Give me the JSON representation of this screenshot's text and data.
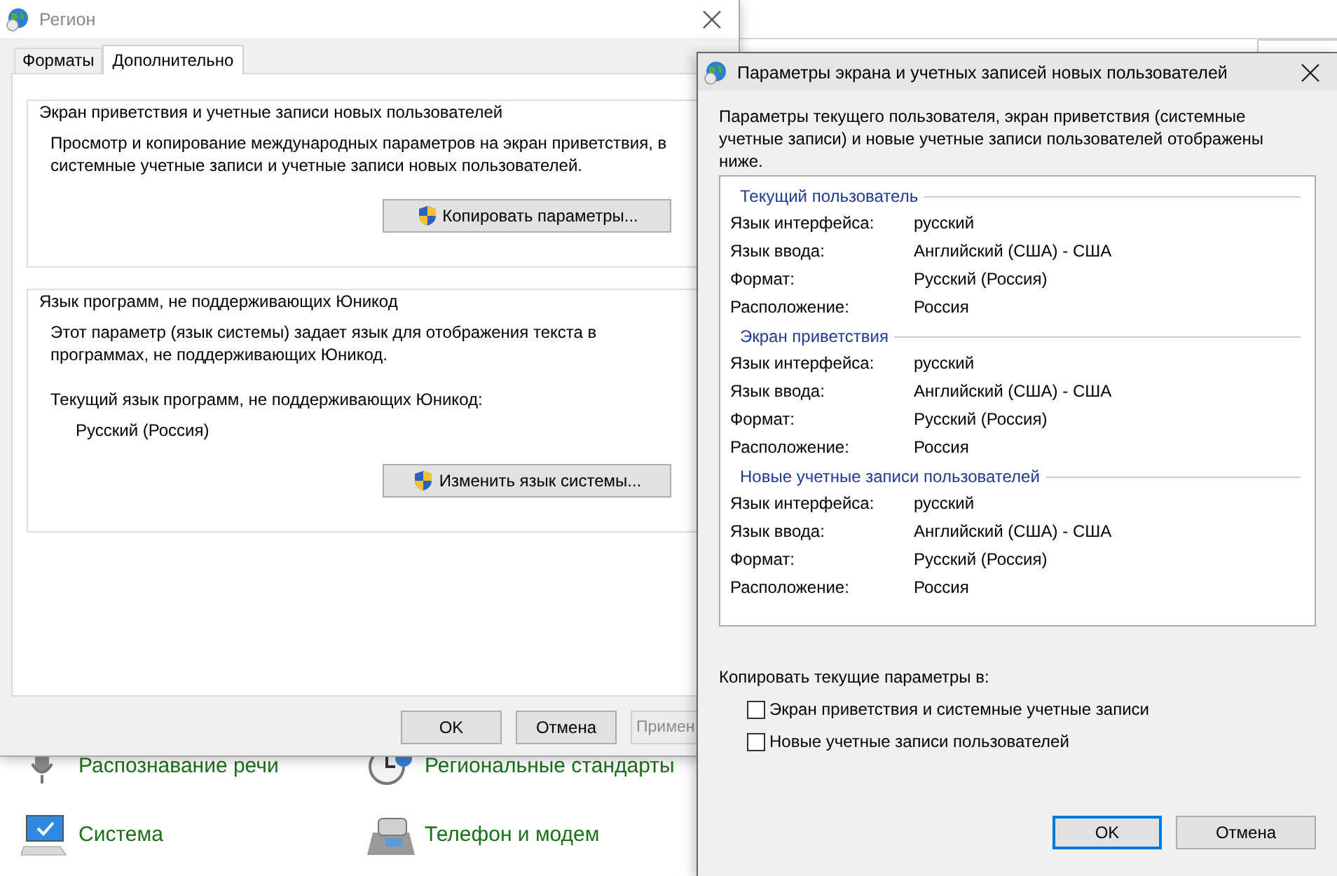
{
  "control_panel": {
    "items": [
      {
        "kind": "microphone",
        "label": "Распознавание речи"
      },
      {
        "kind": "clock",
        "label": "Региональные стандарты"
      },
      {
        "kind": "monitor",
        "label": "Система"
      },
      {
        "kind": "phone",
        "label": "Телефон и модем"
      }
    ]
  },
  "region_window": {
    "title": "Регион",
    "tabs": [
      {
        "label": "Форматы",
        "selected": false
      },
      {
        "label": "Дополнительно",
        "selected": true
      }
    ],
    "groups": [
      {
        "title": "Экран приветствия и учетные записи новых пользователей",
        "text": "Просмотр и копирование международных параметров на экран приветствия, в системные учетные записи и учетные записи новых пользователей.",
        "button": "Копировать параметры..."
      },
      {
        "title": "Язык программ, не поддерживающих Юникод",
        "text": "Этот параметр (язык системы) задает язык для отображения текста в программах, не поддерживающих Юникод.",
        "current_label": "Текущий язык программ, не поддерживающих Юникод:",
        "current_value": "Русский (Россия)",
        "button": "Изменить язык системы..."
      }
    ],
    "buttons": [
      {
        "label": "OK",
        "disabled": false
      },
      {
        "label": "Отмена",
        "disabled": false
      },
      {
        "label": "Примен",
        "disabled": true
      }
    ]
  },
  "dialog": {
    "title": "Параметры экрана и учетных записей новых пользователей",
    "intro": "Параметры текущего пользователя, экран приветствия (системные учетные записи) и новые учетные записи пользователей отображены ниже.",
    "sections": [
      {
        "title": "Текущий пользователь",
        "rows": [
          {
            "label": "Язык интерфейса:",
            "value": "русский"
          },
          {
            "label": "Язык ввода:",
            "value": "Английский (США) - США"
          },
          {
            "label": "Формат:",
            "value": "Русский (Россия)"
          },
          {
            "label": "Расположение:",
            "value": "Россия"
          }
        ]
      },
      {
        "title": "Экран приветствия",
        "rows": [
          {
            "label": "Язык интерфейса:",
            "value": "русский"
          },
          {
            "label": "Язык ввода:",
            "value": "Английский (США) - США"
          },
          {
            "label": "Формат:",
            "value": "Русский (Россия)"
          },
          {
            "label": "Расположение:",
            "value": "Россия"
          }
        ]
      },
      {
        "title": "Новые учетные записи пользователей",
        "rows": [
          {
            "label": "Язык интерфейса:",
            "value": "русский"
          },
          {
            "label": "Язык ввода:",
            "value": "Английский (США) - США"
          },
          {
            "label": "Формат:",
            "value": "Русский (Россия)"
          },
          {
            "label": "Расположение:",
            "value": "Россия"
          }
        ]
      }
    ],
    "copy_label": "Копировать текущие параметры в:",
    "options": [
      {
        "label": "Экран приветствия и системные учетные записи",
        "checked": false
      },
      {
        "label": "Новые учетные записи пользователей",
        "checked": false
      }
    ],
    "buttons": [
      {
        "label": "OK",
        "default": true
      },
      {
        "label": "Отмена",
        "default": false
      }
    ]
  }
}
